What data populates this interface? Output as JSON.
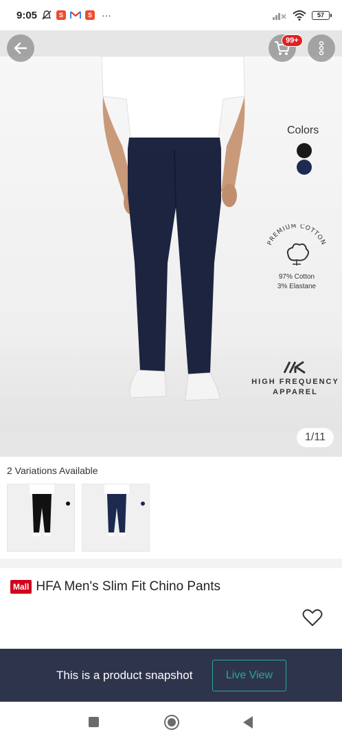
{
  "status_bar": {
    "time": "9:05",
    "more_indicator": "···",
    "battery": "57",
    "icons": [
      "notifications-off-icon",
      "shopee-icon",
      "gmail-icon",
      "shopee-icon",
      "signal-icon",
      "wifi-icon",
      "battery-icon"
    ]
  },
  "header": {
    "cart_badge": "99+",
    "icons": [
      "back-arrow-icon",
      "cart-icon",
      "more-vertical-icon"
    ]
  },
  "hero": {
    "colors_label": "Colors",
    "swatch_colors": [
      "#1a1a1a",
      "#1e2a52"
    ],
    "premium_badge": "PREMIUM COTTON",
    "composition": [
      "97% Cotton",
      "3% Elastane"
    ],
    "brand": [
      "HIGH FREQUENCY",
      "APPAREL"
    ],
    "page_indicator": "1/11"
  },
  "variations": {
    "title": "2 Variations Available",
    "items": [
      {
        "name": "variant-black",
        "swatch": "#111111"
      },
      {
        "name": "variant-navy",
        "swatch": "#1d2a50"
      }
    ]
  },
  "product": {
    "badge": "Mall",
    "title": "HFA Men's Slim Fit Chino Pants"
  },
  "snapshot": {
    "text": "This is a product snapshot",
    "button": "Live View"
  },
  "colors": {
    "accent_teal": "#26aa99",
    "mall_red": "#d0011b",
    "snapshot_bg": "#2e344b",
    "badge_red": "#e02020"
  }
}
